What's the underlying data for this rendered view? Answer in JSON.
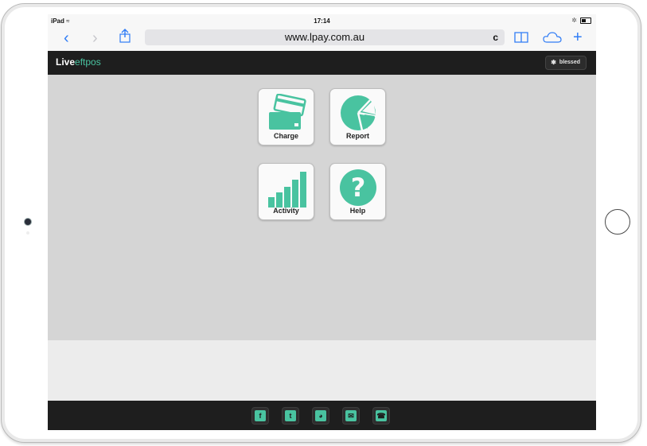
{
  "statusbar": {
    "device": "iPad",
    "time": "17:14"
  },
  "browser": {
    "url": "www.lpay.com.au",
    "reload_glyph": "c"
  },
  "app": {
    "logo_main": "Live",
    "logo_accent": "eftpos",
    "user_label": "blessed",
    "accent_color": "#49c3a0"
  },
  "tiles": [
    {
      "label": "Charge",
      "icon": "card-icon"
    },
    {
      "label": "Report",
      "icon": "pie-chart-icon"
    },
    {
      "label": "Activity",
      "icon": "bar-chart-icon"
    },
    {
      "label": "Help",
      "icon": "help-icon"
    }
  ],
  "footer": {
    "links": [
      {
        "glyph": "f",
        "icon": "facebook-icon"
      },
      {
        "glyph": "t",
        "icon": "twitter-icon"
      },
      {
        "glyph": "◕",
        "icon": "web-icon"
      },
      {
        "glyph": "✉",
        "icon": "email-icon"
      },
      {
        "glyph": "☎",
        "icon": "phone-icon"
      }
    ]
  }
}
